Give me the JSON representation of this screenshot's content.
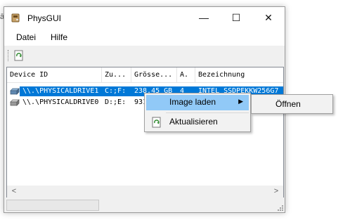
{
  "window": {
    "title": "PhysGUI"
  },
  "caption_buttons": {
    "minimize": "—",
    "maximize": "☐",
    "close": "✕"
  },
  "menubar": {
    "items": [
      "Datei",
      "Hilfe"
    ]
  },
  "toolbar": {
    "refresh_icon": "refresh-icon"
  },
  "table": {
    "columns": [
      "Device ID",
      "Zu...",
      "Grösse...",
      "A.",
      "Bezeichnung"
    ],
    "rows": [
      [
        "\\\\.\\PHYSICALDRIVE1",
        "C:;F:",
        "238,45 GB",
        "4",
        "INTEL SSDPEKKW256G7"
      ],
      [
        "\\\\.\\PHYSICALDRIVE0",
        "D:;E:",
        "931",
        "",
        ""
      ]
    ],
    "selected_row": 0
  },
  "scrollbar": {
    "left": "<",
    "right": ">"
  },
  "context_menu": {
    "items": [
      "Image laden",
      "Aktualisieren"
    ],
    "highlighted": "Image laden",
    "submenu_arrow": "▶",
    "submenu": [
      "Öffnen"
    ]
  },
  "colors": {
    "selection": "#0078d7",
    "menu_highlight": "#91c9f7"
  }
}
